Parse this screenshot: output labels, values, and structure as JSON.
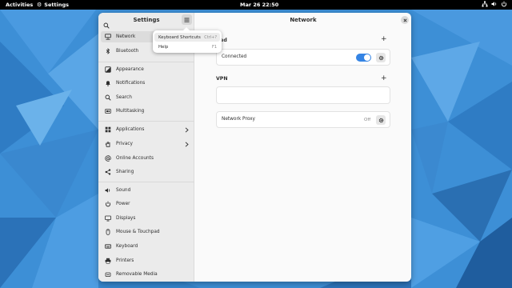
{
  "topbar": {
    "activities": "Activities",
    "app_name": "Settings",
    "clock": "Mar 26  22:50"
  },
  "window": {
    "sidebar_title": "Settings",
    "content_title": "Network",
    "sidebar": {
      "items": [
        {
          "label": "Network",
          "icon": "network-wired-icon"
        },
        {
          "label": "Bluetooth",
          "icon": "bluetooth-icon"
        },
        {
          "label": "Appearance",
          "icon": "appearance-icon"
        },
        {
          "label": "Notifications",
          "icon": "bell-icon"
        },
        {
          "label": "Search",
          "icon": "search-icon"
        },
        {
          "label": "Multitasking",
          "icon": "multitasking-icon"
        },
        {
          "label": "Applications",
          "icon": "applications-icon"
        },
        {
          "label": "Privacy",
          "icon": "privacy-hand-icon"
        },
        {
          "label": "Online Accounts",
          "icon": "at-sign-icon"
        },
        {
          "label": "Sharing",
          "icon": "share-icon"
        },
        {
          "label": "Sound",
          "icon": "speaker-icon"
        },
        {
          "label": "Power",
          "icon": "power-icon"
        },
        {
          "label": "Displays",
          "icon": "display-icon"
        },
        {
          "label": "Mouse & Touchpad",
          "icon": "mouse-icon"
        },
        {
          "label": "Keyboard",
          "icon": "keyboard-icon"
        },
        {
          "label": "Printers",
          "icon": "printer-icon"
        },
        {
          "label": "Removable Media",
          "icon": "removable-media-icon"
        }
      ]
    },
    "menu_popover": {
      "items": [
        {
          "label": "Keyboard Shortcuts",
          "shortcut": "Ctrl+?"
        },
        {
          "label": "Help",
          "shortcut": "F1"
        }
      ]
    },
    "network": {
      "wired": {
        "title": "ired",
        "status": "Connected",
        "enabled": true
      },
      "vpn": {
        "title": "VPN"
      },
      "proxy": {
        "label": "Network Proxy",
        "state": "Off"
      }
    }
  },
  "colors": {
    "accent": "#3584e4",
    "topbar": "#000000",
    "wallpaper_base": "#3d8fd6"
  }
}
